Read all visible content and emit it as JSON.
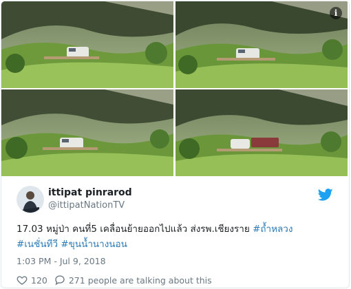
{
  "photos": [
    {
      "name": "photo-1"
    },
    {
      "name": "photo-2"
    },
    {
      "name": "photo-3"
    },
    {
      "name": "photo-4"
    }
  ],
  "info_icon": {
    "glyph": "i",
    "icon": "info-icon"
  },
  "author": {
    "name": "ittipat pinrarod",
    "handle": "@ittipatNationTV"
  },
  "tweet": {
    "text": "17.03 หมู่ป่า คนที่5 เคลื่อนย้ายออกไปแล้ว ส่งรพ.เชียงราย ",
    "hashtags": [
      "#ถ้ำหลวง",
      "#เนชั่นทีวี",
      "#ขุนน้ำนางนอน"
    ],
    "timestamp": "1:03 PM - Jul 9, 2018"
  },
  "actions": {
    "like_count": "120",
    "reply_text": "271 people are talking about this"
  },
  "colors": {
    "accent": "#1da1f2",
    "hashtag": "#2b7bb9",
    "muted": "#697882"
  }
}
